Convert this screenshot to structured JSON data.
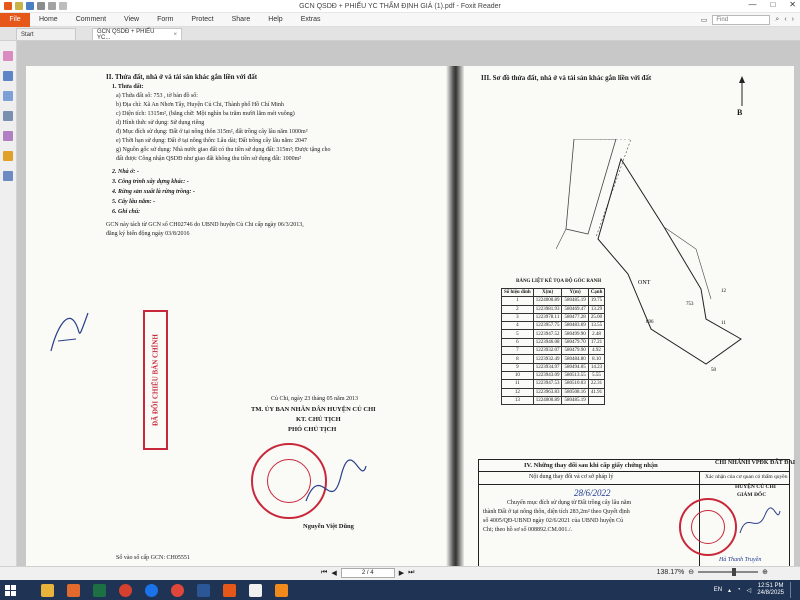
{
  "window": {
    "title": "GCN QSDĐ + PHIẾU YC THẨM ĐỊNH GIÁ (1).pdf - Foxit Reader",
    "minimize_icon": "minimize-icon",
    "maximize_icon": "maximize-icon",
    "close_icon": "close-icon"
  },
  "menu": {
    "file": "File",
    "items": [
      "Home",
      "Comment",
      "View",
      "Form",
      "Protect",
      "Share",
      "Help",
      "Extras"
    ],
    "find_placeholder": "Find"
  },
  "tabs": [
    {
      "label": "Start"
    },
    {
      "label": "GCN QSDĐ + PHIẾU YC...",
      "close": "×"
    }
  ],
  "document": {
    "left": {
      "section_title": "II. Thửa đất, nhà ở và tài sản khác gắn liền với đất",
      "sub1": "1. Thửa đất:",
      "lines": [
        "a) Thửa đất số:       753                , tờ bản đồ số:",
        "b) Địa chỉ:  Xã An Nhơn Tây, Huyện Củ Chi, Thành phố Hồ Chí Minh",
        "c) Diện tích:        1315m², (bằng chữ: Một nghìn ba trăm mười lăm mét vuông)",
        "d) Hình thức sử dụng:      Sử dụng riêng",
        "đ) Mục đích sử dụng:  Đất ở tại nông thôn 315m², đất trồng cây lâu năm 1000m²",
        "e) Thời hạn sử dụng:     Đất ở tại nông thôn: Lâu dài; Đất trồng cây lâu năm: 2047",
        "g) Nguồn gốc sử dụng:  Nhà nước giao đất có thu tiền sử dụng đất: 315m²; Được tặng cho",
        "đất được Công nhận QSDĐ như giao đất không thu tiền sử dụng đất: 1000m²"
      ],
      "items": [
        "2. Nhà ở: -",
        "3. Công trình xây dựng khác: -",
        "4. Rừng sản xuất là rừng trồng: -",
        "5. Cây lâu năm: -",
        "6. Ghi chú:"
      ],
      "note": [
        "GCN này tách từ GCN số CH02746  do UBND huyện Củ Chi cấp ngày  06/3/2013,",
        "đăng ký biến động ngày  03/8/2016"
      ],
      "date_line": "Củ Chi, ngày  23 tháng 05  năm 2013",
      "sign": [
        "TM. ỦY BAN NHÂN DÂN HUYỆN CỦ CHI",
        "KT. CHỦ TỊCH",
        "PHÓ CHỦ TỊCH"
      ],
      "signer": "Nguyễn Việt Dũng",
      "register_no": "Số vào sổ cấp GCN:  CH05551",
      "stamp_text": "ĐÃ ĐỐI CHIẾU BẢN CHÍNH"
    },
    "right": {
      "section_title": "III. Sơ đồ thửa đất, nhà ở và tài sản khác gắn liền với đất",
      "north": "B",
      "table_title": "BẢNG LIỆT KÊ TỌA ĐỘ GÓC RANH",
      "table_headers": [
        "Số hiệu đỉnh",
        "X(m)",
        "Y(m)",
        "Cạnh"
      ],
      "rows": [
        [
          "1",
          "1224000.89",
          "580485.19",
          "19.75"
        ],
        [
          "2",
          "1223981.93",
          "580469.47",
          "13.29"
        ],
        [
          "3",
          "1223978.11",
          "580477.28",
          "25.00"
        ],
        [
          "4",
          "1223957.75",
          "580483.69",
          "13.55"
        ],
        [
          "5",
          "1223947.52",
          "580499.90",
          "2.48"
        ],
        [
          "6",
          "1223946.08",
          "580479.70",
          "17.21"
        ],
        [
          "7",
          "1223932.07",
          "580479.90",
          "4.92"
        ],
        [
          "8",
          "1223932.49",
          "580484.80",
          "8.10"
        ],
        [
          "9",
          "1223934.97",
          "580494.05",
          "14.23"
        ],
        [
          "10",
          "1223943.09",
          "580513.55",
          "5.55"
        ],
        [
          "11",
          "1223947.53",
          "580510.03",
          "22.31"
        ],
        [
          "12",
          "1223963.83",
          "580508.16",
          "41.91"
        ],
        [
          "13",
          "1224000.89",
          "580485.19",
          ""
        ]
      ],
      "diagram_labels": [
        "ONT",
        "753",
        "12",
        "11",
        "696",
        "50"
      ],
      "box_title": "IV. Những thay đổi sau khi cấp giấy chứng nhận",
      "box_col1": "Nội dung thay đổi và cơ sở pháp lý",
      "box_col2": "Xác nhận của cơ quan có thẩm quyền",
      "box_text": [
        "Chuyển mục đích sử dụng từ Đất trồng cây lâu năm",
        "thành Đất ở tại nông thôn, diện tích 283,2m² theo Quyết định",
        "số 4005/QĐ-UBND ngày 02/6/2021 của UBND huyện Củ",
        "Chi; theo hồ sơ số 008892.CM.001./."
      ],
      "box_date": "28/6/2022",
      "box_right": [
        "CHI NHÁNH VPĐK ĐẤT ĐAI",
        "HUYỆN CỦ CHI",
        "GIÁM ĐỐC"
      ],
      "box_signer": "Hà Thanh Truyền"
    }
  },
  "status": {
    "page": "2 / 4",
    "zoom": "138.17%",
    "zoom_fraction": 0.6
  },
  "taskbar": {
    "apps": [
      "file-explorer-icon",
      "media-icon",
      "excel-icon",
      "chrome-icon",
      "zalo-icon",
      "chrome-icon",
      "word-icon",
      "foxit-icon",
      "pdf-icon",
      "app-g-icon"
    ],
    "lang": "EN",
    "time": "12:51 PM",
    "date": "24/8/2025"
  },
  "colors": {
    "file_tab": "#e6571a",
    "taskbar": "#1f3454",
    "stamp": "#c8283a"
  }
}
